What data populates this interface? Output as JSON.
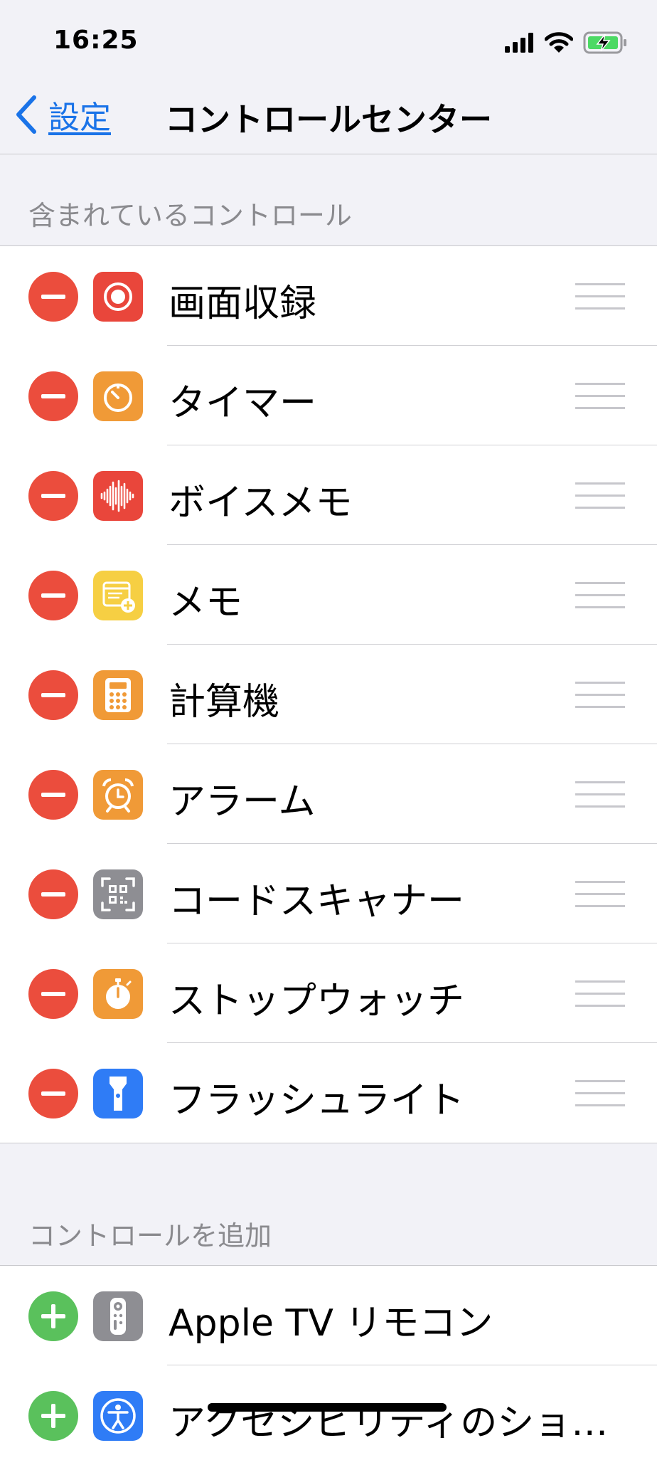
{
  "status": {
    "time": "16:25"
  },
  "nav": {
    "back_label": "設定",
    "title": "コントロールセンター"
  },
  "included": {
    "header": "含まれているコントロール",
    "items": [
      {
        "label": "画面収録",
        "icon": "screen-record-icon",
        "color": "#e9463b"
      },
      {
        "label": "タイマー",
        "icon": "timer-icon",
        "color": "#f09a37"
      },
      {
        "label": "ボイスメモ",
        "icon": "voice-memo-icon",
        "color": "#e9463b"
      },
      {
        "label": "メモ",
        "icon": "note-icon",
        "color": "#f6cf43"
      },
      {
        "label": "計算機",
        "icon": "calculator-icon",
        "color": "#f09a37"
      },
      {
        "label": "アラーム",
        "icon": "alarm-icon",
        "color": "#f09a37"
      },
      {
        "label": "コードスキャナー",
        "icon": "qr-code-icon",
        "color": "#8e8e93"
      },
      {
        "label": "ストップウォッチ",
        "icon": "stopwatch-icon",
        "color": "#f09a37"
      },
      {
        "label": "フラッシュライト",
        "icon": "flashlight-icon",
        "color": "#2f7cf6"
      }
    ]
  },
  "more": {
    "header": "コントロールを追加",
    "items": [
      {
        "label": "Apple TV リモコン",
        "icon": "tv-remote-icon",
        "color": "#8e8e93"
      },
      {
        "label": "アクセシビリティのショ…",
        "icon": "accessibility-icon",
        "color": "#2f7cf6"
      }
    ]
  }
}
